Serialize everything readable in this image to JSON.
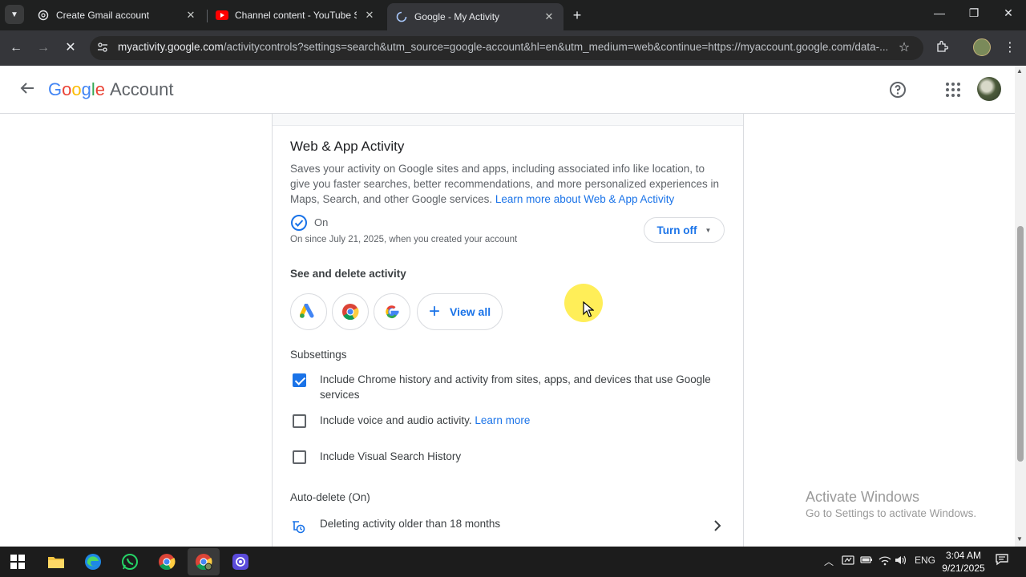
{
  "browser": {
    "tabs": [
      {
        "title": "Create Gmail account",
        "icon": "chatgpt-icon",
        "close": "✕"
      },
      {
        "title": "Channel content - YouTube Studio",
        "icon": "youtube-icon",
        "close": "✕"
      },
      {
        "title": "Google - My Activity",
        "icon": "loading-icon",
        "close": "✕",
        "active": true
      }
    ],
    "new_tab": "+",
    "url_host": "myactivity.google.com",
    "url_path": "/activitycontrols?settings=search&utm_source=google-account&hl=en&utm_medium=web&continue=https://myaccount.google.com/data-..."
  },
  "header": {
    "brand_letters": [
      "G",
      "o",
      "o",
      "g",
      "l",
      "e"
    ],
    "brand_suffix": "Account"
  },
  "section": {
    "title": "Web & App Activity",
    "description": "Saves your activity on Google sites and apps, including associated info like location, to give you faster searches, better recommendations, and more personalized experiences in Maps, Search, and other Google services.",
    "learn_more": "Learn more about Web & App Activity",
    "status": "On",
    "status_since": "On since July 21, 2025, when you created your account",
    "turn_off": "Turn off"
  },
  "see_delete": {
    "heading": "See and delete activity",
    "apps": [
      "google-ads-icon",
      "chrome-icon",
      "google-icon"
    ],
    "view_all": "View all"
  },
  "subsettings": {
    "heading": "Subsettings",
    "items": [
      {
        "label": "Include Chrome history and activity from sites, apps, and devices that use Google services",
        "checked": true
      },
      {
        "label": "Include voice and audio activity.",
        "link": "Learn more",
        "checked": false
      },
      {
        "label": "Include Visual Search History",
        "checked": false
      }
    ]
  },
  "autodelete": {
    "heading": "Auto-delete (On)",
    "text": "Deleting activity older than 18 months"
  },
  "watermark": {
    "line1": "Activate Windows",
    "line2": "Go to Settings to activate Windows."
  },
  "taskbar": {
    "apps": [
      "windows-start-icon",
      "file-explorer-icon",
      "edge-icon",
      "whatsapp-icon",
      "chrome-icon",
      "chrome-profile-icon",
      "screen-recorder-icon"
    ],
    "language": "ENG",
    "time": "3:04 AM",
    "date": "9/21/2025"
  },
  "colors": {
    "accent": "#1a73e8",
    "chrome_dark": "#35363a",
    "taskbar": "#1c1c1c"
  }
}
